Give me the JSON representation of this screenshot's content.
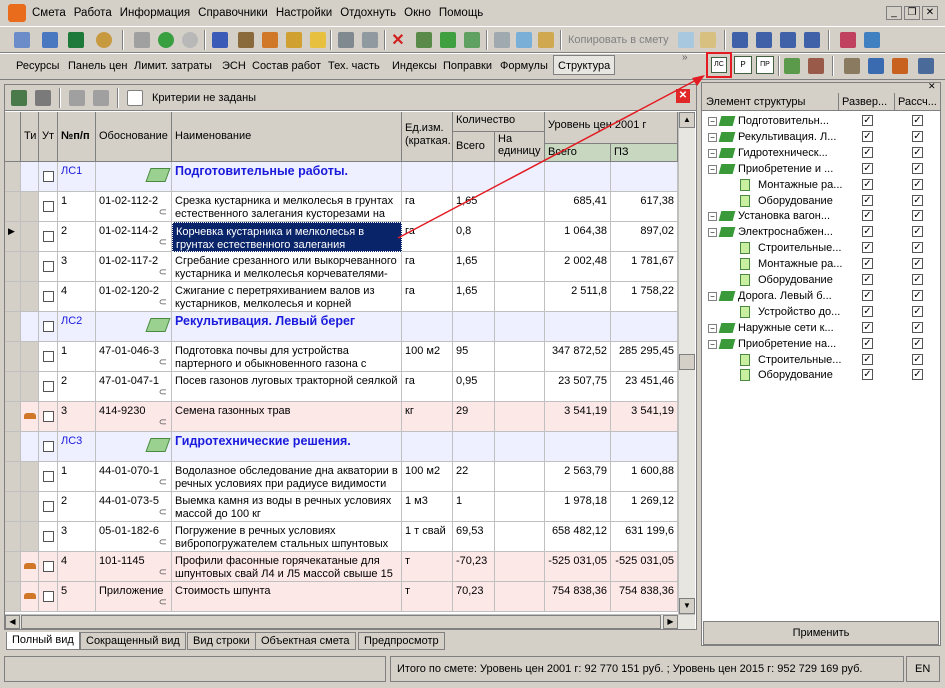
{
  "menu": [
    "Смета",
    "Работа",
    "Информация",
    "Справочники",
    "Настройки",
    "Отдохнуть",
    "Окно",
    "Помощь"
  ],
  "window_controls": [
    "_",
    "❐",
    "✕"
  ],
  "toolbar": {
    "copy_to_estimate": "Копировать в смету"
  },
  "tabs": [
    "Ресурсы",
    "Панель цен",
    "Лимит. затраты",
    "ЭСН",
    "Состав работ",
    "Тех. часть",
    "Индексы",
    "Поправки",
    "Формулы",
    "Структура"
  ],
  "filter": {
    "criteria": "Критерии не заданы"
  },
  "grid": {
    "headers": {
      "ti": "Ти",
      "ut": "Ут",
      "num": "№п/п",
      "basis": "Обоснование",
      "name": "Наименование",
      "unit": "Ед.изм. (краткая.",
      "qty": "Количество",
      "qty_total": "Всего",
      "qty_per": "На единицу",
      "price": "Уровень цен 2001 г",
      "price_total": "Всего",
      "pz": "ПЗ"
    },
    "rows": [
      {
        "kind": "section",
        "num": "ЛС1",
        "name": "Подготовительные работы."
      },
      {
        "kind": "item",
        "num": "1",
        "basis": "01-02-112-2",
        "name": "Срезка кустарника и мелколесья в грунтах естественного залегания кусторезами на",
        "unit": "га",
        "qty": "1,65",
        "total": "685,41",
        "pz": "617,38"
      },
      {
        "kind": "item",
        "num": "2",
        "basis": "01-02-114-2",
        "name": "Корчевка кустарника и мелколесья в грунтах естественного залегания",
        "unit": "га",
        "qty": "0,8",
        "total": "1 064,38",
        "pz": "897,02",
        "selected": true
      },
      {
        "kind": "item",
        "num": "3",
        "basis": "01-02-117-2",
        "name": "Сгребание срезанного или выкорчеванного кустарника и мелколесья корчевателями-",
        "unit": "га",
        "qty": "1,65",
        "total": "2 002,48",
        "pz": "1 781,67"
      },
      {
        "kind": "item",
        "num": "4",
        "basis": "01-02-120-2",
        "name": "Сжигание с перетряхиванием валов из кустарников, мелколесья и корней",
        "unit": "га",
        "qty": "1,65",
        "total": "2 511,8",
        "pz": "1 758,22"
      },
      {
        "kind": "section",
        "num": "ЛС2",
        "name": "Рекультивация. Левый берег"
      },
      {
        "kind": "item",
        "num": "1",
        "basis": "47-01-046-3",
        "name": "Подготовка почвы для устройства партерного и обыкновенного газона с",
        "unit": "100 м2",
        "qty": "95",
        "total": "347 872,52",
        "pz": "285 295,45"
      },
      {
        "kind": "item",
        "num": "2",
        "basis": "47-01-047-1",
        "name": "Посев газонов луговых тракторной сеялкой",
        "unit": "га",
        "qty": "0,95",
        "total": "23 507,75",
        "pz": "23 451,46"
      },
      {
        "kind": "material",
        "num": "3",
        "basis": "414-9230",
        "name": "Семена газонных трав",
        "unit": "кг",
        "qty": "29",
        "total": "3 541,19",
        "pz": "3 541,19"
      },
      {
        "kind": "section",
        "num": "ЛС3",
        "name": "Гидротехнические решения."
      },
      {
        "kind": "item",
        "num": "1",
        "basis": "44-01-070-1",
        "name": "Водолазное обследование дна акватории в речных условиях при радиусе видимости",
        "unit": "100 м2",
        "qty": "22",
        "total": "2 563,79",
        "pz": "1 600,88"
      },
      {
        "kind": "item",
        "num": "2",
        "basis": "44-01-073-5",
        "name": "Выемка камня из воды в речных условиях массой до 100 кг",
        "unit": "1 м3",
        "qty": "1",
        "total": "1 978,18",
        "pz": "1 269,12"
      },
      {
        "kind": "item",
        "num": "3",
        "basis": "05-01-182-6",
        "name": "Погружение в речных условиях вибропогружателем стальных шпунтовых",
        "unit": "1 т свай",
        "qty": "69,53",
        "total": "658 482,12",
        "pz": "631 199,6"
      },
      {
        "kind": "material",
        "num": "4",
        "basis": "101-1145",
        "name": "Профили фасонные горячекатаные для шпунтовых свай Л4 и Л5 массой свыше 15",
        "unit": "т",
        "qty": "-70,23",
        "total": "-525 031,05",
        "pz": "-525 031,05"
      },
      {
        "kind": "material",
        "num": "5",
        "basis": "Приложение",
        "name": "Стоимость шпунта",
        "unit": "т",
        "qty": "70,23",
        "total": "754 838,36",
        "pz": "754 838,36"
      }
    ]
  },
  "bottom_tabs": [
    "Полный вид",
    "Сокращенный вид",
    "Вид строки",
    "Объектная смета",
    "Предпросмотр"
  ],
  "right_panel": {
    "icons": [
      "ЛС",
      "Р",
      "ПР"
    ],
    "headers": {
      "element": "Элемент структуры",
      "expand": "Развер...",
      "calc": "Рассч..."
    },
    "tree": [
      {
        "level": 0,
        "label": "Подготовительн..."
      },
      {
        "level": 0,
        "label": "Рекультивация. Л..."
      },
      {
        "level": 0,
        "label": "Гидротехническ..."
      },
      {
        "level": 0,
        "label": "Приобретение и ..."
      },
      {
        "level": 1,
        "label": "Монтажные ра..."
      },
      {
        "level": 1,
        "label": "Оборудование"
      },
      {
        "level": 0,
        "label": "Установка вагон..."
      },
      {
        "level": 0,
        "label": "Электроснабжен..."
      },
      {
        "level": 1,
        "label": "Строительные..."
      },
      {
        "level": 1,
        "label": "Монтажные ра..."
      },
      {
        "level": 1,
        "label": "Оборудование"
      },
      {
        "level": 0,
        "label": "Дорога. Левый б..."
      },
      {
        "level": 1,
        "label": "Устройство до..."
      },
      {
        "level": 0,
        "label": "Наружные сети к..."
      },
      {
        "level": 0,
        "label": "Приобретение на..."
      },
      {
        "level": 1,
        "label": "Строительные..."
      },
      {
        "level": 1,
        "label": "Оборудование"
      }
    ],
    "apply": "Применить"
  },
  "status": {
    "total": "Итого по смете: Уровень цен 2001 г: 92 770 151 руб. ;  Уровень цен 2015 г: 952 729 169 руб.",
    "lang": "EN"
  },
  "colors": {
    "section_text": "#1a1adc",
    "section_bg": "#eef0ff",
    "material_bg": "#fde8e8",
    "selected_bg": "#0a246a",
    "accent": "#e31b23"
  }
}
